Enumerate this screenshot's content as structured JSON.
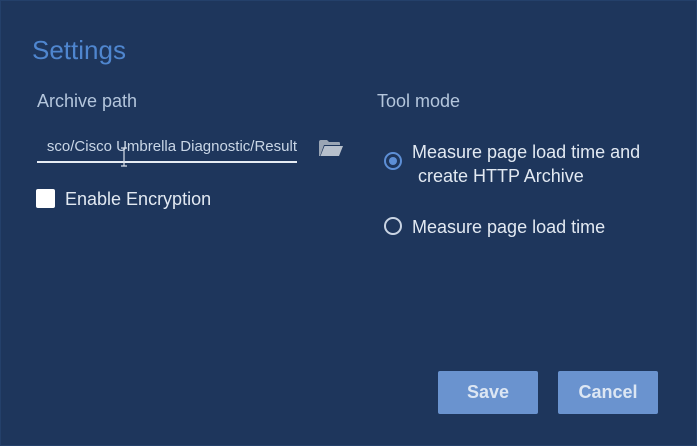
{
  "dialog": {
    "title": "Settings"
  },
  "archive": {
    "label": "Archive path",
    "path_value": "sco/Cisco Umbrella Diagnostic/Result",
    "browse_icon": "folder-icon"
  },
  "encryption": {
    "label": "Enable Encryption",
    "checked": false
  },
  "tool_mode": {
    "label": "Tool mode",
    "options": [
      {
        "line1": "Measure page load time and",
        "line2": "create HTTP Archive",
        "selected": true
      },
      {
        "line1": "Measure page load time",
        "selected": false
      }
    ]
  },
  "buttons": {
    "save": "Save",
    "cancel": "Cancel"
  },
  "colors": {
    "background": "#1e365c",
    "title": "#4f86cf",
    "button": "#6a93cf",
    "radio_selected": "#5d8fd6"
  }
}
